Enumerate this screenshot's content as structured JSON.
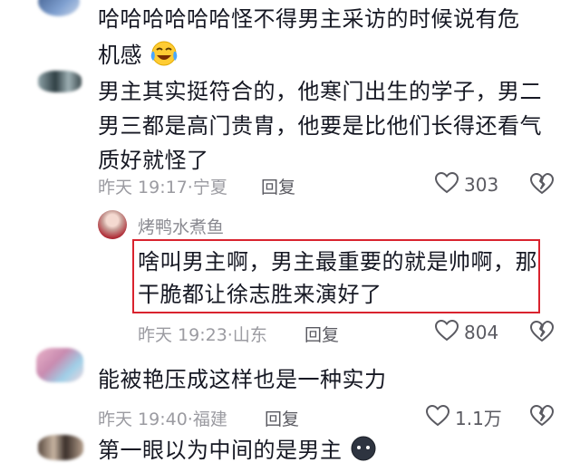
{
  "comments": [
    {
      "text_lines": [
        "哈哈哈哈哈哈怪不得男主采访的时候说有危",
        "机感"
      ],
      "emoji": "crying-laughing-emoji"
    },
    {
      "text_lines": [
        "男主其实挺符合的，他寒门出生的学子，男二",
        "男三都是高门贵胄，他要是比他们长得还看气",
        "质好就怪了"
      ],
      "time": "昨天 19:17",
      "separator": "·",
      "location": "宁夏",
      "reply_label": "回复",
      "likes": "303"
    },
    {
      "username": "烤鸭水煮鱼",
      "text_lines": [
        "啥叫男主啊，男主最重要的就是帅啊，那",
        "干脆都让徐志胜来演好了"
      ],
      "time": "昨天 19:23",
      "separator": "·",
      "location": "山东",
      "reply_label": "回复",
      "likes": "804"
    },
    {
      "text_lines": [
        "能被艳压成这样也是一种实力"
      ],
      "time": "昨天 19:40",
      "separator": "·",
      "location": "福建",
      "reply_label": "回复",
      "likes": "1.1万"
    },
    {
      "text_lines": [
        "第一眼以为中间的是男主"
      ],
      "emoji": "dark-face-emoji"
    }
  ],
  "colors": {
    "text": "#161823",
    "meta": "#9b9ba1",
    "highlight": "#d9232e"
  }
}
